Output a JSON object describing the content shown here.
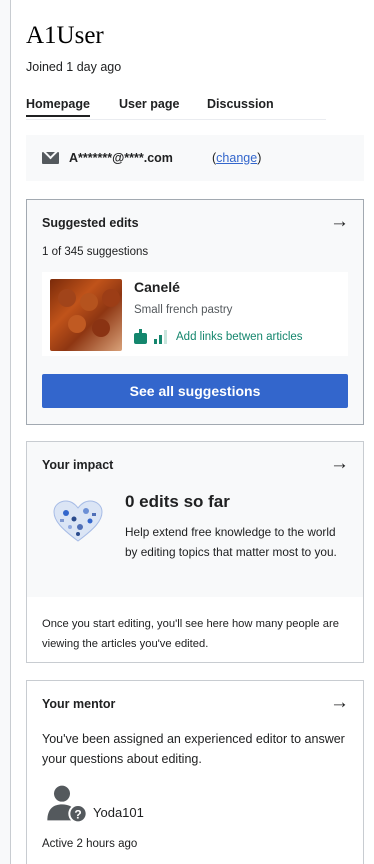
{
  "user": {
    "name": "A1User",
    "joined": "Joined 1 day ago"
  },
  "tabs": [
    {
      "label": "Homepage",
      "active": true
    },
    {
      "label": "User page",
      "active": false
    },
    {
      "label": "Discussion",
      "active": false
    }
  ],
  "email": {
    "address": "A*******@****.com",
    "change_open": "(",
    "change_label": "change",
    "change_close": ")",
    "icon": "mail-icon"
  },
  "suggested_edits": {
    "title": "Suggested edits",
    "count": "1 of 345 suggestions",
    "item": {
      "name": "Canelé",
      "description": "Small french pastry",
      "task": "Add links betwen articles",
      "task_color": "#14866d"
    },
    "button_label": "See all suggestions",
    "button_color": "#3366cc",
    "arrow": "→"
  },
  "impact": {
    "title": "Your impact",
    "headline": "0 edits so far",
    "description": "Help extend free knowledge to the world by editing topics that matter most to you.",
    "footer": "Once you start editing, you'll see here how many people are viewing the articles you've edited.",
    "arrow": "→"
  },
  "mentor": {
    "title": "Your mentor",
    "description": "You've been assigned an experienced editor to answer your questions about editing.",
    "name": "Yoda101",
    "status": "Active 2 hours ago",
    "arrow": "→"
  }
}
